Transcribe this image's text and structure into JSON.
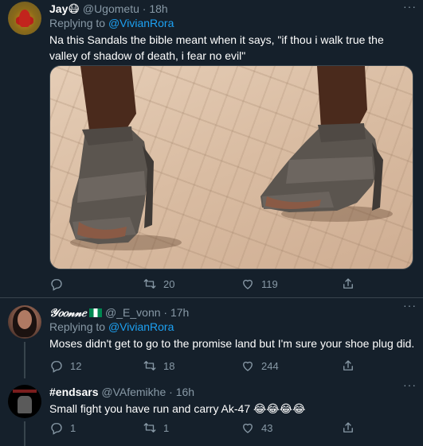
{
  "tweets": [
    {
      "name": "Jay",
      "name_emoji": "😷",
      "handle": "@Ugometu",
      "separator": "·",
      "time": "18h",
      "replying_prefix": "Replying to",
      "replying_to": "@VivianRora",
      "text": "Na this Sandals the bible meant when it says, \"if thou i walk true the valley of shadow of death, i fear no evil\"",
      "reply_count": "",
      "retweet_count": "20",
      "like_count": "119",
      "has_media": true
    },
    {
      "name": "𝒴𝑜𝑜𝓃𝓃𝑒",
      "name_flag": "nigeria-flag",
      "handle": "@_E_vonn",
      "separator": "·",
      "time": "17h",
      "replying_prefix": "Replying to",
      "replying_to": "@VivianRora",
      "text": "Moses didn't get to go to the promise land but I'm sure your shoe plug did.",
      "reply_count": "12",
      "retweet_count": "18",
      "like_count": "244"
    },
    {
      "name": "#endsars",
      "handle": "@VAfemikhe",
      "separator": "·",
      "time": "16h",
      "text": "Small fight you have run and carry Ak-47 😂😂😂😂",
      "reply_count": "1",
      "retweet_count": "1",
      "like_count": "43"
    }
  ],
  "more_icon": "···",
  "colors": {
    "background": "#15202b",
    "secondary_text": "#8899a6",
    "link": "#1da1f2",
    "divider": "#38444d"
  }
}
